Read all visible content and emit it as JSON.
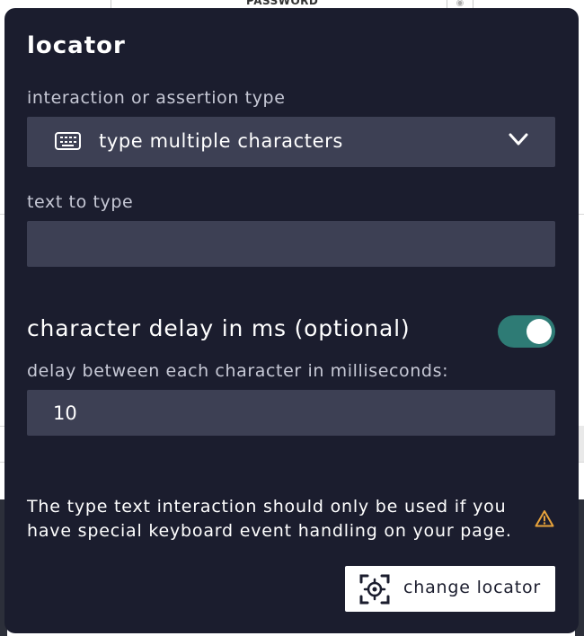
{
  "background": {
    "password_label": "PASSWORD"
  },
  "panel": {
    "title": "locator",
    "interaction_label": "interaction or assertion type",
    "interaction_select": {
      "icon": "keyboard-icon",
      "value": "type multiple characters"
    },
    "text_to_type": {
      "label": "text to type",
      "value": ""
    },
    "character_delay": {
      "title": "character delay in ms (optional)",
      "toggle_on": true,
      "field_label": "delay between each character in milliseconds:",
      "value": "10"
    },
    "note": "The type text interaction should only be used if you have special keyboard event handling on your page.",
    "change_locator_button": "change locator"
  },
  "colors": {
    "panel_bg": "#1b1d2e",
    "field_bg": "#3d4054",
    "toggle_on": "#2e7b75",
    "warning": "#e8a33b"
  }
}
